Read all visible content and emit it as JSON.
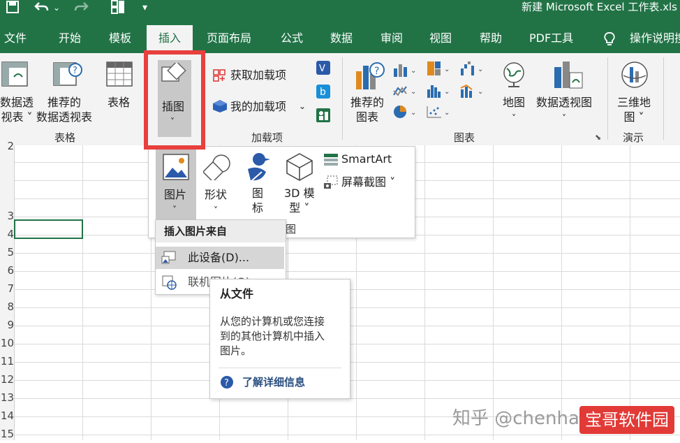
{
  "title_bar": {
    "title": "新建 Microsoft Excel 工作表.xls"
  },
  "tabs": [
    "文件",
    "开始",
    "模板",
    "插入",
    "页面布局",
    "公式",
    "数据",
    "审阅",
    "视图",
    "帮助",
    "PDF工具",
    "操作说明搜"
  ],
  "ribbon": {
    "pivot_l1": "数据透",
    "pivot_l2": "视表 ˅",
    "rec_l1": "推荐的",
    "rec_l2": "数据透视表",
    "table": "表格",
    "illus": "插图",
    "illus_arrow": "˅",
    "get_addins": "获取加载项",
    "my_addins": "我的加载项",
    "rec_chart_l1": "推荐的",
    "rec_chart_l2": "图表",
    "map": "地图",
    "map_arrow": "˅",
    "pivot_chart": "数据透视图",
    "pivot_chart_arrow": "˅",
    "map3d_l1": "三维地",
    "map3d_l2": "图 ˅",
    "group_tables": "表格",
    "group_addins": "加载项",
    "group_charts": "图表",
    "group_tours": "演示"
  },
  "row_numbers": [
    "2",
    "3",
    "4",
    "5",
    "6",
    "7",
    "8",
    "9",
    "10",
    "11",
    "12",
    "13",
    "14",
    "15"
  ],
  "illustrations_menu": {
    "pictures": "图片",
    "pictures_arrow": "˅",
    "shapes": "形状",
    "shapes_arrow": "˅",
    "icons_l1": "图",
    "icons_l2": "标",
    "model_l1": "3D 模",
    "model_l2": "型 ˅",
    "smartart": "SmartArt",
    "screenshot": "屏幕截图 ˅",
    "group_label": "图"
  },
  "insert_picture_menu": {
    "header": "插入图片来自",
    "this_device": "此设备(D)...",
    "online": "联机图片(O)..."
  },
  "tooltip": {
    "title": "从文件",
    "body_l1": "从您的计算机或您连接",
    "body_l2": "到的其他计算机中插入",
    "body_l3": "图片。",
    "link": "了解详细信息"
  },
  "watermark": "知乎 @chenhan",
  "badge": "宝哥软件园",
  "colors": {
    "excel_green": "#217346",
    "highlight_red": "#e8403e"
  }
}
